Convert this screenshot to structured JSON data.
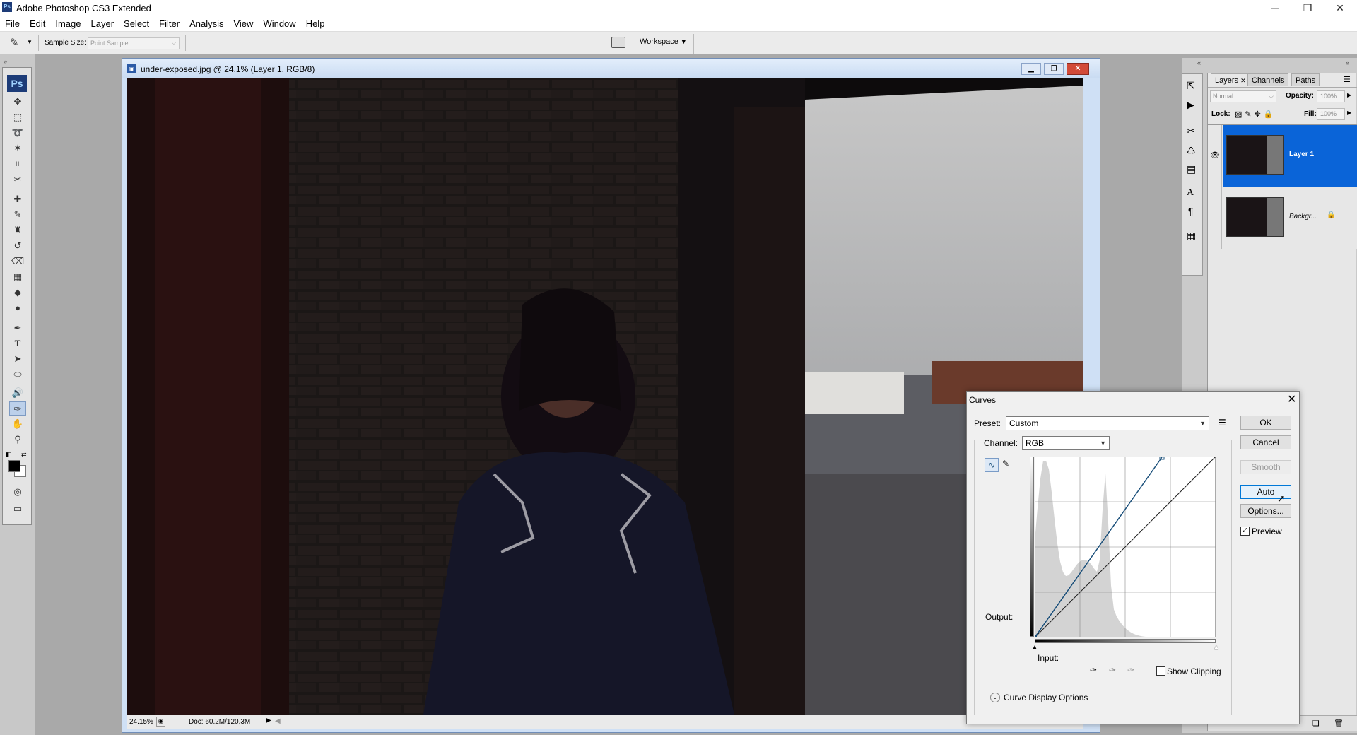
{
  "app": {
    "title": "Adobe Photoshop CS3 Extended",
    "icon_label": "Ps",
    "window_controls": {
      "minimize": "─",
      "maximize": "❐",
      "close": "✕"
    }
  },
  "menu": [
    "File",
    "Edit",
    "Image",
    "Layer",
    "Select",
    "Filter",
    "Analysis",
    "View",
    "Window",
    "Help"
  ],
  "options_bar": {
    "sample_size_label": "Sample Size:",
    "sample_size_value": "Point Sample",
    "workspace_label": "Workspace"
  },
  "toolbox": {
    "logo": "Ps",
    "tools": [
      "move-tool-icon",
      "marquee-tool-icon",
      "lasso-tool-icon",
      "magic-wand-icon",
      "crop-tool-icon",
      "slice-tool-icon",
      "healing-brush-icon",
      "brush-tool-icon",
      "clone-stamp-icon",
      "history-brush-icon",
      "eraser-tool-icon",
      "gradient-tool-icon",
      "blur-tool-icon",
      "dodge-tool-icon",
      "pen-tool-icon",
      "type-tool-icon",
      "path-select-icon",
      "shape-tool-icon",
      "notes-tool-icon",
      "eyedropper-tool-icon",
      "hand-tool-icon",
      "zoom-tool-icon"
    ],
    "fg_color": "#000000",
    "bg_color": "#ffffff"
  },
  "document": {
    "title": "under-exposed.jpg @ 24.1% (Layer 1, RGB/8)",
    "zoom": "24.15%",
    "doc_info": "Doc: 60.2M/120.3M"
  },
  "layers_panel": {
    "tabs": [
      "Layers",
      "Channels",
      "Paths"
    ],
    "blend_mode": "Normal",
    "opacity_label": "Opacity:",
    "opacity_value": "100%",
    "lock_label": "Lock:",
    "fill_label": "Fill:",
    "fill_value": "100%",
    "layers": [
      {
        "name": "Layer 1",
        "selected": true,
        "visible": true
      },
      {
        "name": "Backgr...",
        "selected": false,
        "visible": false,
        "locked": true
      }
    ]
  },
  "curves_dialog": {
    "title": "Curves",
    "preset_label": "Preset:",
    "preset_value": "Custom",
    "channel_label": "Channel:",
    "channel_value": "RGB",
    "output_label": "Output:",
    "input_label": "Input:",
    "buttons": {
      "ok": "OK",
      "cancel": "Cancel",
      "smooth": "Smooth",
      "auto": "Auto",
      "options": "Options..."
    },
    "preview_label": "Preview",
    "preview_checked": true,
    "show_clipping_label": "Show Clipping",
    "show_clipping_checked": false,
    "curve_display_options": "Curve Display Options",
    "curve": {
      "input_black": 0,
      "input_white": 180,
      "output_black": 0,
      "output_white": 255
    }
  },
  "colors": {
    "accent_selection": "#0a64d8",
    "curve_line": "#1a4f7a"
  }
}
